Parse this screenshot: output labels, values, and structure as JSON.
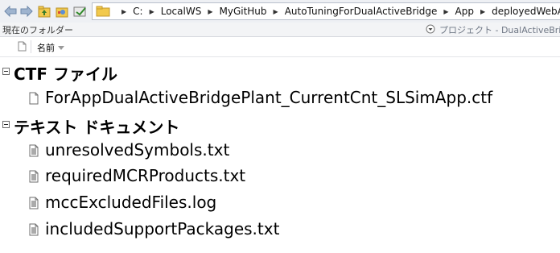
{
  "toolbar": {
    "back_icon": "back-arrow-icon",
    "forward_icon": "forward-arrow-icon",
    "up_icon": "up-folder-icon",
    "browse_icon": "browse-folder-icon"
  },
  "address": {
    "crumbs": [
      "C:",
      "LocalWS",
      "MyGitHub",
      "AutoTuningForDualActiveBridge",
      "App",
      "deployedWebApp"
    ]
  },
  "current_folder": {
    "label": "現在のフォルダー",
    "project": "プロジェクト - DualActiveBrid"
  },
  "column_header": {
    "name": "名前"
  },
  "groups": [
    {
      "label": "CTF ファイル",
      "files": [
        "ForAppDualActiveBridgePlant_CurrentCnt_SLSimApp.ctf"
      ]
    },
    {
      "label": "テキスト ドキュメント",
      "files": [
        "unresolvedSymbols.txt",
        "requiredMCRProducts.txt",
        "mccExcludedFiles.log",
        "includedSupportPackages.txt"
      ]
    }
  ],
  "colors": {
    "toolbar_bg": "#eef0f4",
    "folder_yellow": "#f2c94c",
    "project_text": "#6f7785"
  }
}
